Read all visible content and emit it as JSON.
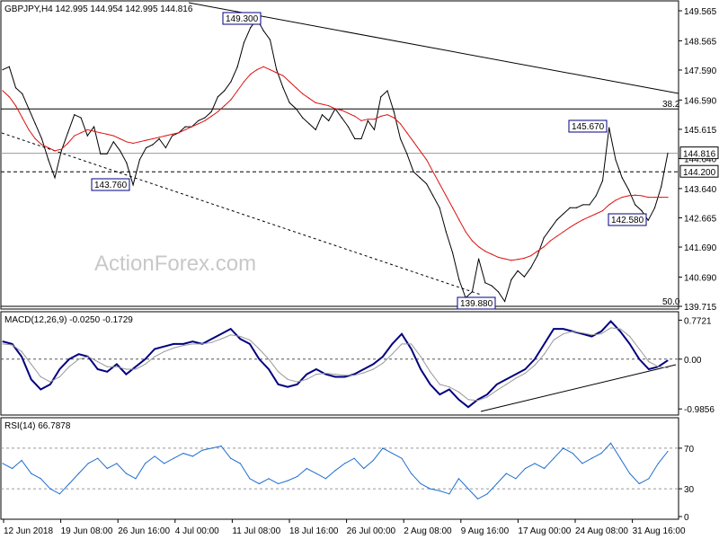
{
  "chart_data": {
    "type": "line",
    "x": [
      "12 Jun 2018",
      "19 Jun 08:00",
      "26 Jun 16:00",
      "4 Jul 00:00",
      "11 Jul 08:00",
      "18 Jul 16:00",
      "26 Jul 00:00",
      "2 Aug 08:00",
      "9 Aug 16:00",
      "17 Aug 00:00",
      "24 Aug 08:00",
      "31 Aug 16:00"
    ],
    "watermark": "ActionForex.com",
    "panels": [
      {
        "id": "price",
        "title": "GBPJPY,H4  142.995 144.954 142.995 144.816",
        "ylim": [
          139.715,
          149.565
        ],
        "yticks": [
          139.715,
          140.69,
          141.69,
          142.665,
          143.64,
          144.64,
          145.615,
          146.59,
          147.59,
          148.565,
          149.565
        ],
        "ytick_labels": [
          "139.715",
          "140.690",
          "141.690",
          "142.665",
          "143.640",
          "144.640",
          "145.615",
          "146.590",
          "147.590",
          "148.565",
          "149.565"
        ],
        "series": [
          {
            "name": "",
            "color": "#000000",
            "values": [
              147.6,
              147.7,
              147.0,
              146.8,
              146.3,
              145.8,
              145.3,
              144.6,
              144.0,
              144.9,
              145.5,
              146.1,
              146.0,
              145.4,
              145.7,
              144.8,
              144.8,
              145.2,
              144.9,
              144.5,
              143.76,
              144.6,
              145.0,
              145.1,
              145.3,
              145.0,
              145.4,
              145.5,
              145.7,
              145.7,
              145.9,
              146.0,
              146.2,
              146.7,
              146.9,
              147.2,
              147.7,
              148.5,
              149.0,
              149.3,
              148.9,
              148.6,
              147.6,
              147.0,
              146.5,
              146.3,
              146.0,
              145.8,
              145.6,
              146.1,
              145.9,
              146.3,
              146.0,
              145.7,
              145.3,
              145.3,
              145.9,
              145.6,
              146.7,
              146.9,
              146.2,
              145.3,
              144.8,
              144.2,
              144.0,
              143.8,
              143.4,
              143.0,
              142.2,
              141.5,
              140.6,
              140.0,
              140.2,
              141.3,
              140.5,
              140.4,
              140.2,
              139.88,
              140.6,
              140.9,
              140.7,
              141.0,
              141.4,
              142.0,
              142.3,
              142.6,
              142.8,
              143.0,
              143.0,
              143.1,
              143.1,
              143.4,
              143.9,
              145.67,
              144.6,
              144.0,
              143.6,
              143.1,
              142.9,
              142.58,
              143.0,
              143.7,
              144.816
            ]
          },
          {
            "name": "",
            "color": "#dd1111",
            "values": [
              146.9,
              146.7,
              146.4,
              146.0,
              145.6,
              145.3,
              145.1,
              145.0,
              144.9,
              144.95,
              145.15,
              145.4,
              145.5,
              145.6,
              145.55,
              145.5,
              145.45,
              145.4,
              145.3,
              145.2,
              145.15,
              145.2,
              145.25,
              145.3,
              145.35,
              145.4,
              145.45,
              145.5,
              145.6,
              145.7,
              145.8,
              145.9,
              146.05,
              146.2,
              146.4,
              146.6,
              146.9,
              147.2,
              147.45,
              147.6,
              147.7,
              147.6,
              147.5,
              147.4,
              147.2,
              147.0,
              146.8,
              146.65,
              146.5,
              146.45,
              146.4,
              146.3,
              146.25,
              146.15,
              146.05,
              145.9,
              145.95,
              145.95,
              146.05,
              146.1,
              146.0,
              145.8,
              145.5,
              145.2,
              144.9,
              144.6,
              144.2,
              143.8,
              143.4,
              143.0,
              142.6,
              142.2,
              141.9,
              141.7,
              141.55,
              141.45,
              141.35,
              141.3,
              141.25,
              141.28,
              141.32,
              141.4,
              141.55,
              141.7,
              141.9,
              142.05,
              142.2,
              142.35,
              142.48,
              142.6,
              142.7,
              142.8,
              142.9,
              143.1,
              143.25,
              143.35,
              143.4,
              143.42,
              143.4,
              143.35,
              143.35,
              143.35,
              143.35
            ]
          }
        ],
        "hlines": [
          {
            "value": 146.295,
            "style": "solid",
            "label": "38.2"
          },
          {
            "value": 144.2,
            "style": "dashed",
            "label": "144.200"
          },
          {
            "value": 144.816,
            "style": "solid",
            "label": "144.816"
          },
          {
            "value": 139.715,
            "style": "solid",
            "label": "50.0"
          }
        ],
        "annotations": [
          "149.300",
          "143.760",
          "139.880",
          "145.670",
          "142.580"
        ]
      },
      {
        "id": "macd",
        "title": "MACD(12,26,9) -0.0250 -0.1729",
        "ylim": [
          -1.0,
          0.85
        ],
        "yticks": [
          0.7721,
          0.0,
          -0.9856
        ],
        "ytick_labels": [
          "0.7721",
          "0.00",
          "-0.9856"
        ],
        "series": [
          {
            "name": "",
            "color": "#000080",
            "values": [
              0.35,
              0.3,
              0.05,
              -0.4,
              -0.6,
              -0.5,
              -0.2,
              0.0,
              0.1,
              0.05,
              -0.2,
              -0.25,
              -0.1,
              -0.3,
              -0.15,
              0.0,
              0.2,
              0.25,
              0.3,
              0.3,
              0.35,
              0.3,
              0.4,
              0.5,
              0.6,
              0.4,
              0.3,
              0.0,
              -0.2,
              -0.5,
              -0.55,
              -0.5,
              -0.3,
              -0.2,
              -0.3,
              -0.35,
              -0.35,
              -0.3,
              -0.2,
              -0.1,
              0.05,
              0.3,
              0.5,
              0.2,
              -0.2,
              -0.5,
              -0.7,
              -0.6,
              -0.8,
              -0.95,
              -0.8,
              -0.7,
              -0.5,
              -0.4,
              -0.3,
              -0.2,
              0.0,
              0.3,
              0.6,
              0.6,
              0.55,
              0.5,
              0.45,
              0.55,
              0.75,
              0.55,
              0.3,
              0.0,
              -0.2,
              -0.15,
              -0.025
            ]
          },
          {
            "name": "",
            "color": "#999999",
            "values": [
              0.3,
              0.28,
              0.15,
              -0.1,
              -0.35,
              -0.45,
              -0.35,
              -0.15,
              0.0,
              0.05,
              -0.05,
              -0.15,
              -0.15,
              -0.2,
              -0.2,
              -0.1,
              0.05,
              0.15,
              0.22,
              0.27,
              0.3,
              0.3,
              0.33,
              0.4,
              0.48,
              0.45,
              0.38,
              0.2,
              0.0,
              -0.25,
              -0.4,
              -0.45,
              -0.4,
              -0.3,
              -0.28,
              -0.3,
              -0.32,
              -0.32,
              -0.27,
              -0.2,
              -0.08,
              0.1,
              0.3,
              0.3,
              0.05,
              -0.25,
              -0.5,
              -0.55,
              -0.65,
              -0.8,
              -0.82,
              -0.75,
              -0.62,
              -0.5,
              -0.38,
              -0.28,
              -0.12,
              0.1,
              0.38,
              0.5,
              0.55,
              0.52,
              0.48,
              0.5,
              0.62,
              0.6,
              0.45,
              0.2,
              -0.05,
              -0.15,
              -0.1729
            ]
          }
        ]
      },
      {
        "id": "rsi",
        "title": "RSI(14) 66.7878",
        "ylim": [
          0,
          100
        ],
        "yticks": [
          70,
          30,
          0
        ],
        "ytick_labels": [
          "70",
          "30",
          "0"
        ],
        "series": [
          {
            "name": "",
            "color": "#1f6fd1",
            "values": [
              55,
              50,
              58,
              45,
              40,
              30,
              25,
              35,
              45,
              55,
              60,
              50,
              55,
              45,
              40,
              55,
              62,
              55,
              60,
              65,
              62,
              68,
              70,
              72,
              60,
              55,
              40,
              35,
              40,
              35,
              38,
              42,
              50,
              45,
              40,
              48,
              55,
              60,
              50,
              58,
              70,
              65,
              60,
              45,
              35,
              30,
              28,
              25,
              40,
              30,
              20,
              25,
              35,
              45,
              40,
              50,
              55,
              50,
              60,
              70,
              65,
              55,
              60,
              65,
              75,
              60,
              45,
              35,
              40,
              55,
              66.79
            ]
          }
        ]
      }
    ]
  }
}
